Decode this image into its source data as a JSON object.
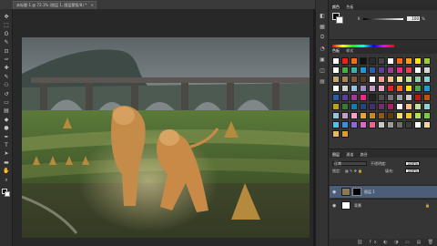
{
  "document_tab": {
    "title": "未标题-1 @ 72.1% (图层 1, 图层蒙版/8) *",
    "close_label": "×"
  },
  "tools": [
    "move-icon",
    "marquee-icon",
    "lasso-icon",
    "quick-select-icon",
    "crop-icon",
    "eyedropper-icon",
    "healing-icon",
    "brush-icon",
    "clone-stamp-icon",
    "history-brush-icon",
    "eraser-icon",
    "gradient-icon",
    "blur-icon",
    "dodge-icon",
    "pen-icon",
    "type-icon",
    "path-select-icon",
    "shape-icon",
    "hand-icon",
    "zoom-icon"
  ],
  "tool_glyphs": [
    "✥",
    "⬚",
    "ʘ",
    "✎",
    "⊡",
    "✑",
    "✚",
    "✎",
    "⚇",
    "↺",
    "▭",
    "▤",
    "◆",
    "●",
    "✒",
    "T",
    "➤",
    "▬",
    "✋",
    "⌕"
  ],
  "color_panel": {
    "tabs": [
      "颜色",
      "色板"
    ],
    "slider_label": "K",
    "slider_value": "100",
    "unit": "%"
  },
  "swatch_panel": {
    "tabs": [
      "色板",
      "样式"
    ],
    "swatches": [
      "#ffffff",
      "#e6231f",
      "#f26e1f",
      "#111111",
      "#2a2a2a",
      "#444444",
      "#ffffff",
      "#f36b21",
      "#f6a01a",
      "#f9e21a",
      "#9ecb3b",
      "#ffffff",
      "#4ba946",
      "#35b4ae",
      "#1d9ad7",
      "#2a5faa",
      "#594196",
      "#9a3d97",
      "#ec2a86",
      "#ed3b51",
      "#ffffff",
      "#d8d8d8",
      "#c7a87a",
      "#a4845d",
      "#7d5a3b",
      "#5b3d25",
      "#ffffff",
      "#f39a94",
      "#f8c18e",
      "#fce59a",
      "#c6e09a",
      "#99d0a0",
      "#90d2d0",
      "#ffffff",
      "#d0d0d0",
      "#9ac0e3",
      "#9b90c6",
      "#c59ec8",
      "#f2a4c7",
      "#e6231f",
      "#f26e1f",
      "#f9e21a",
      "#4ba946",
      "#1d9ad7",
      "#2a5faa",
      "#594196",
      "#9a3d97",
      "#ec2a86",
      "#222222",
      "#4d4d4d",
      "#767676",
      "#a0a0a0",
      "#cccccc",
      "#b81d1d",
      "#b8541a",
      "#b9a415",
      "#367c33",
      "#177ba9",
      "#1f4781",
      "#432f70",
      "#732d71",
      "#b01f64",
      "#ffffff",
      "#f8c18e",
      "#c6e09a",
      "#90d2d0",
      "#9ac0e3",
      "#c59ec8",
      "#f2a4c7",
      "#e8a33a",
      "#c58a2e",
      "#8a5d1e",
      "#5b3d12",
      "#f5e26a",
      "#f0c832",
      "#b4e05a",
      "#7ec94a",
      "#54c0e8",
      "#3a8fd8",
      "#8a6ad8",
      "#d86ac8",
      "#e86a8a",
      "#c8c8c8",
      "#9b9b9b",
      "#6d6d6d",
      "#3d3d3d",
      "#ffffff",
      "#f2d7a0",
      "#e8b86a",
      "#d89a3a"
    ]
  },
  "layers_panel": {
    "tabs": [
      "图层",
      "通道",
      "路径"
    ],
    "blend_mode": "正常",
    "opacity_label": "不透明度:",
    "opacity_value": "100%",
    "lock_label": "锁定:",
    "fill_label": "填充:",
    "fill_value": "100%",
    "layers": [
      {
        "name": "图层 1",
        "selected": true,
        "has_mask": true
      },
      {
        "name": "背景",
        "selected": false,
        "has_mask": false
      }
    ],
    "footer_icons": "⛓ fx ◐ ◑ ▭ ▤ 🗑"
  },
  "right_icons": [
    "◧",
    "▦",
    "⛭",
    "◔",
    "▣",
    "◫",
    "▤"
  ]
}
